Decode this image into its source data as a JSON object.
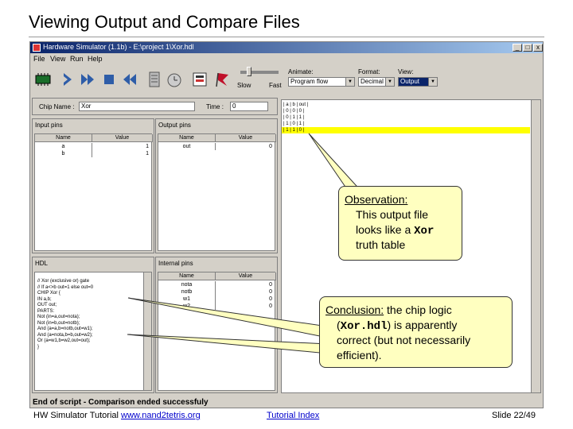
{
  "slide": {
    "title": "Viewing Output and Compare Files",
    "footer_left_prefix": "HW Simulator Tutorial ",
    "footer_link": "www.nand2tetris.org",
    "footer_center": "Tutorial Index",
    "footer_right": "Slide 22/49"
  },
  "window": {
    "title": "Hardware Simulator (1.1b) - E:\\project 1\\Xor.hdl",
    "controls": [
      "_",
      "□",
      "x"
    ],
    "menu": [
      "File",
      "View",
      "Run",
      "Help"
    ]
  },
  "toolbar": {
    "icons": [
      "chip-load-icon",
      "single-step-icon",
      "fast-forward-icon",
      "stop-icon",
      "rewind-icon",
      "script-icon",
      "clock-icon",
      "breakpoint-icon",
      "flag-icon"
    ],
    "speed_slow": "Slow",
    "speed_fast": "Fast",
    "speed_level": 0.2,
    "animate_label": "Animate:",
    "animate_value": "Program flow",
    "format_label": "Format:",
    "format_value": "Decimal",
    "view_label": "View:",
    "view_value": "Output"
  },
  "chip": {
    "name_label": "Chip Name :",
    "name_value": "Xor",
    "time_label": "Time :",
    "time_value": "0"
  },
  "input_pins": {
    "title": "Input pins",
    "headers": [
      "Name",
      "Value"
    ],
    "rows": [
      {
        "name": "a",
        "value": "1"
      },
      {
        "name": "b",
        "value": "1"
      }
    ]
  },
  "output_pins": {
    "title": "Output pins",
    "headers": [
      "Name",
      "Value"
    ],
    "rows": [
      {
        "name": "out",
        "value": "0"
      }
    ]
  },
  "hdl": {
    "title": "HDL",
    "lines": [
      "// Xor (exclusive or) gate",
      "// If a<>b out=1 else out=0",
      "CHIP Xor {",
      "  IN a,b;",
      "  OUT out;",
      "  PARTS:",
      "  Not (in=a,out=nota);",
      "  Not (in=b,out=notb);",
      "  And (a=a,b=notb,out=w1);",
      "  And (a=nota,b=b,out=w2);",
      "  Or (a=w1,b=w2,out=out);",
      "}"
    ]
  },
  "internal_pins": {
    "title": "Internal pins",
    "headers": [
      "Name",
      "Value"
    ],
    "rows": [
      {
        "name": "nota",
        "value": "0"
      },
      {
        "name": "notb",
        "value": "0"
      },
      {
        "name": "w1",
        "value": "0"
      },
      {
        "name": "w2",
        "value": "0"
      }
    ]
  },
  "output_file": {
    "lines": [
      "| a | b | out |",
      "| 0 | 0 | 0 |",
      "| 0 | 1 | 1 |",
      "| 1 | 0 | 1 |",
      "| 1 | 1 | 0 |"
    ],
    "highlight_row": 4
  },
  "status": "End of script - Comparison ended successfuly",
  "callouts": {
    "observation": {
      "heading": "Observation:",
      "line1": "This output file",
      "line2_pre": "looks like a ",
      "line2_code": "Xor",
      "line3": "truth table"
    },
    "conclusion": {
      "heading": "Conclusion:",
      "heading_rest": " the chip logic",
      "line2_pre": "(",
      "line2_code": "Xor.hdl",
      "line2_post": ") is apparently",
      "line3": "correct (but not necessarily",
      "line4": "efficient)."
    }
  },
  "colors": {
    "callout_fill": "#ffffc0",
    "highlight": "#ffff00",
    "titlebar": "#0a246a",
    "window_bg": "#d4d0c8"
  }
}
